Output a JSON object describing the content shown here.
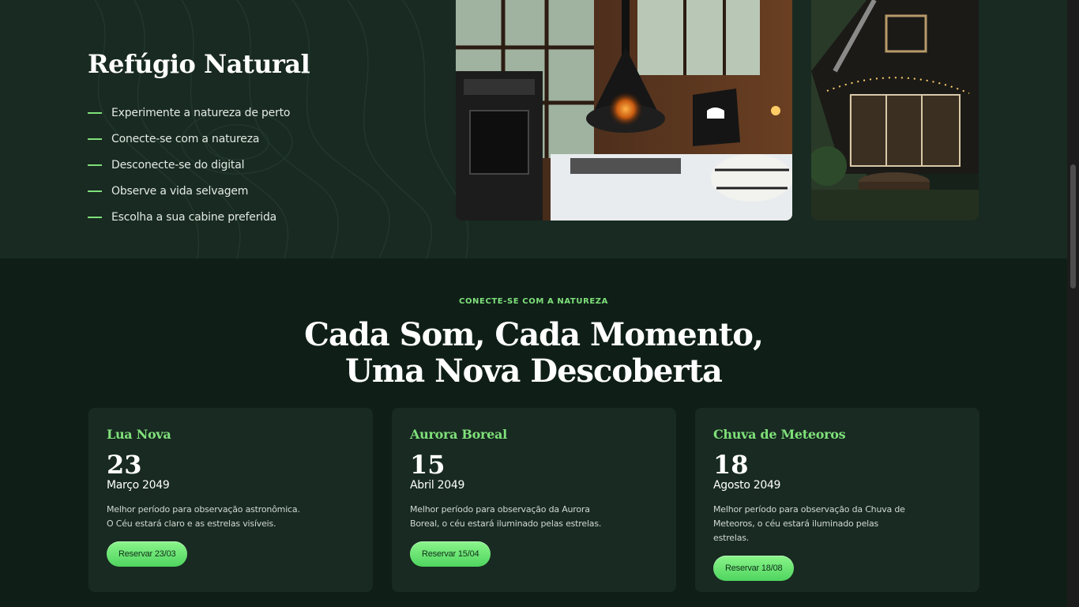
{
  "hero": {
    "title": "Refúgio Natural",
    "features": [
      "Experimente a natureza de perto",
      "Conecte-se com a natureza",
      "Desconecte-se do digital",
      "Observe a vida selvagem",
      "Escolha a sua cabine preferida"
    ]
  },
  "events": {
    "eyebrow": "CONECTE-SE COM A NATUREZA",
    "headline_line1": "Cada Som, Cada Momento,",
    "headline_line2": "Uma Nova Descoberta",
    "cards": [
      {
        "title": "Lua Nova",
        "day": "23",
        "month": "Março 2049",
        "desc": "Melhor período para observação astronômica. O Céu estará claro e as estrelas visíveis.",
        "button": "Reservar 23/03"
      },
      {
        "title": "Aurora Boreal",
        "day": "15",
        "month": "Abril 2049",
        "desc": "Melhor período para observação da Aurora Boreal, o céu estará iluminado pelas estrelas.",
        "button": "Reservar 15/04"
      },
      {
        "title": "Chuva de Meteoros",
        "day": "18",
        "month": "Agosto 2049",
        "desc": "Melhor período para observação da Chuva de Meteoros, o céu estará iluminado pelas estrelas.",
        "button": "Reservar 18/08"
      }
    ]
  },
  "colors": {
    "accent": "#7fe07a",
    "dark_bg": "#0f1f18",
    "panel_bg": "#182a21"
  }
}
